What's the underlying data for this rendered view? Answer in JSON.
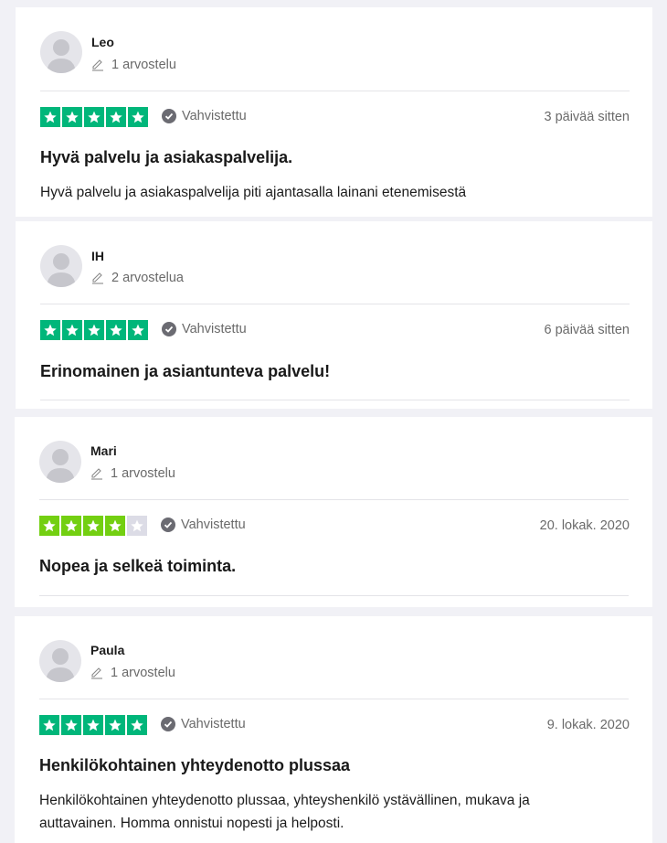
{
  "colors": {
    "star_five": "#00b67a",
    "star_four": "#73cf11",
    "star_empty": "#dcdce6",
    "verified_icon": "#6b6b72"
  },
  "reviews": [
    {
      "name": "Leo",
      "count": "1 arvostelu",
      "rating": 5,
      "verified_label": "Vahvistettu",
      "date": "3 päivää sitten",
      "title": "Hyvä palvelu ja asiakaspalvelija.",
      "body": "Hyvä palvelu ja asiakaspalvelija piti ajantasalla lainani etenemisestä"
    },
    {
      "name": "IH",
      "count": "2 arvostelua",
      "rating": 5,
      "verified_label": "Vahvistettu",
      "date": "6 päivää sitten",
      "title": "Erinomainen ja asiantunteva palvelu!",
      "body": ""
    },
    {
      "name": "Mari",
      "count": "1 arvostelu",
      "rating": 4,
      "verified_label": "Vahvistettu",
      "date": "20. lokak. 2020",
      "title": "Nopea ja selkeä toiminta.",
      "body": ""
    },
    {
      "name": "Paula",
      "count": "1 arvostelu",
      "rating": 5,
      "verified_label": "Vahvistettu",
      "date": "9. lokak. 2020",
      "title": "Henkilökohtainen yhteydenotto plussaa",
      "body_lines": [
        "Henkilökohtainen yhteydenotto plussaa, yhteyshenkilö ystävällinen, mukava ja",
        "auttavainen. Homma onnistui nopesti ja helposti."
      ]
    }
  ]
}
